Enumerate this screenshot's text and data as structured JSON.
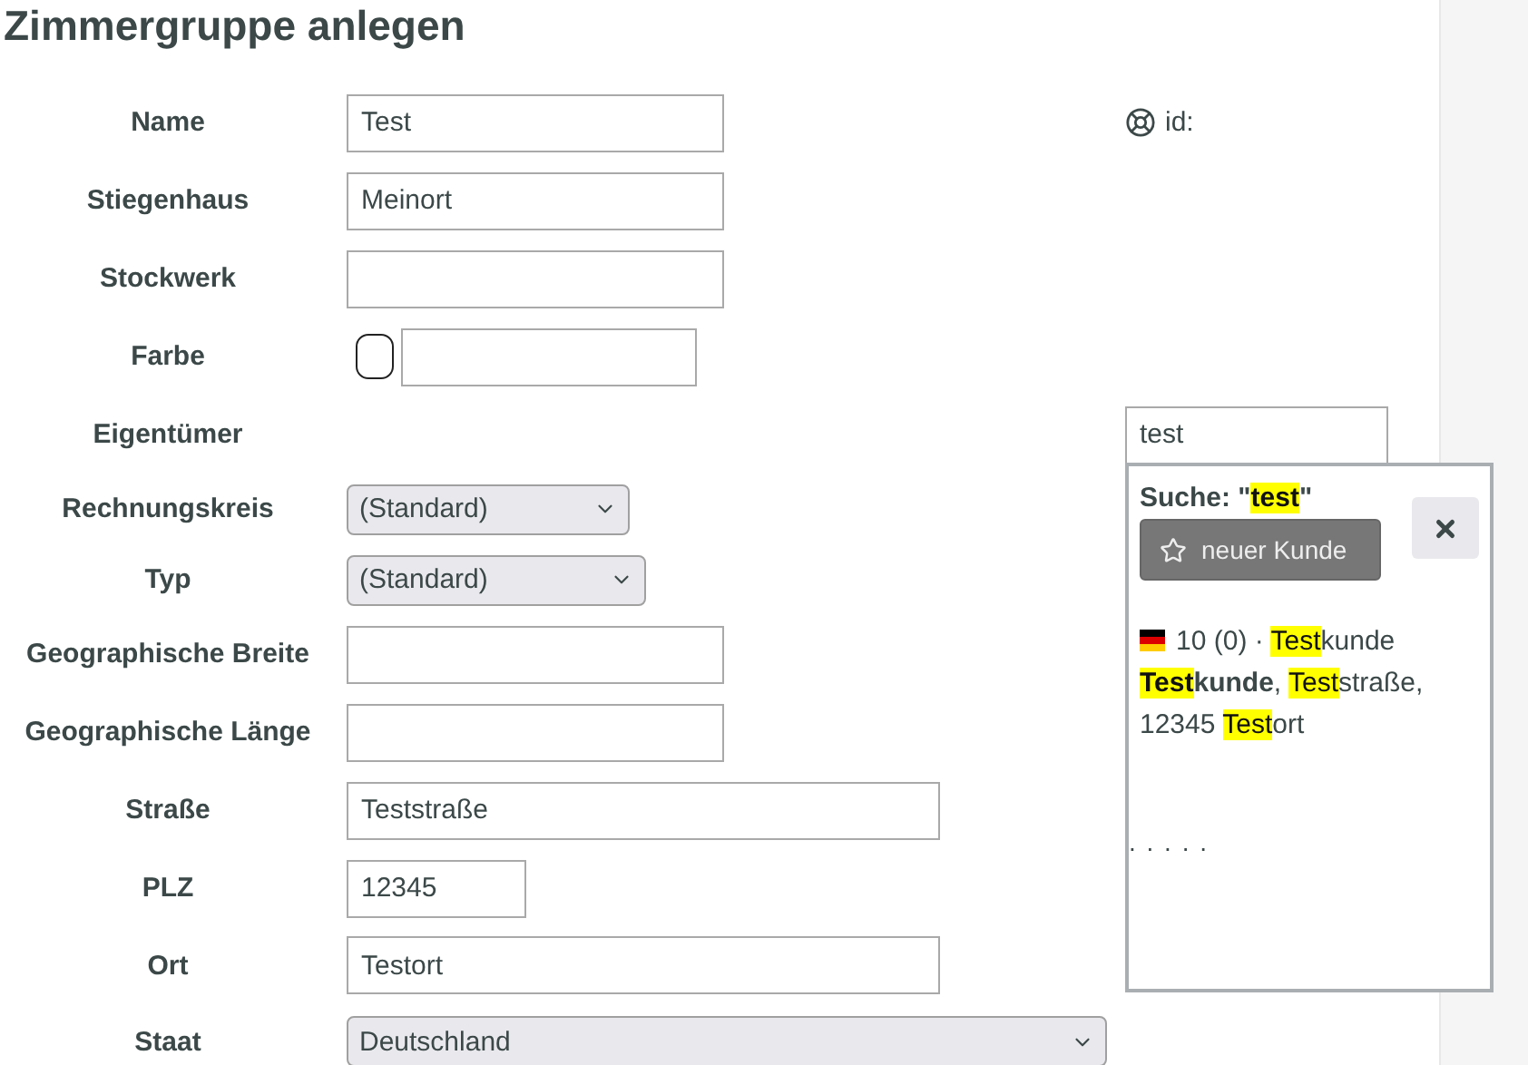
{
  "title": "Zimmergruppe anlegen",
  "id_label": "id:",
  "fields": [
    {
      "label": "Name",
      "kind": "text",
      "value": "Test"
    },
    {
      "label": "Stiegenhaus",
      "kind": "text",
      "value": "Meinort"
    },
    {
      "label": "Stockwerk",
      "kind": "text"
    },
    {
      "label": "Farbe",
      "kind": "color"
    },
    {
      "label": "Eigentümer",
      "kind": "search",
      "value": "test"
    },
    {
      "label": "Rechnungskreis",
      "kind": "select",
      "value": "(Standard)"
    },
    {
      "label": "Typ",
      "kind": "select",
      "value": "(Standard)"
    },
    {
      "label": "Geographische Breite",
      "kind": "text"
    },
    {
      "label": "Geographische Länge",
      "kind": "text"
    },
    {
      "label": "Straße",
      "kind": "text",
      "value": "Teststraße"
    },
    {
      "label": "PLZ",
      "kind": "text",
      "value": "12345"
    },
    {
      "label": "Ort",
      "kind": "text",
      "value": "Testort"
    },
    {
      "label": "Staat",
      "kind": "select",
      "value": "Deutschland"
    }
  ],
  "search_popup": {
    "heading": "Suche: \"",
    "query": "test",
    "heading_end": "\"",
    "new_button": "neuer Kunde",
    "results": [
      {
        "lines": [
          [
            {
              "text": "10 (0) · ",
              "highlight": false,
              "bold": false
            },
            {
              "text": "Test",
              "highlight": true,
              "bold": false
            },
            {
              "text": "kunde",
              "highlight": false,
              "bold": false
            }
          ],
          [
            {
              "text": "Test",
              "highlight": true,
              "bold": true
            },
            {
              "text": "kunde",
              "highlight": false,
              "bold": true
            },
            {
              "text": ", ",
              "highlight": false,
              "bold": false
            },
            {
              "text": "Test",
              "highlight": true,
              "bold": false
            },
            {
              "text": "straße,",
              "highlight": false,
              "bold": false
            }
          ],
          [
            {
              "text": "12345 ",
              "highlight": false,
              "bold": false
            },
            {
              "text": "Test",
              "highlight": true,
              "bold": false
            },
            {
              "text": "ort",
              "highlight": false,
              "bold": false
            }
          ]
        ]
      }
    ],
    "more": ". . . . ."
  }
}
